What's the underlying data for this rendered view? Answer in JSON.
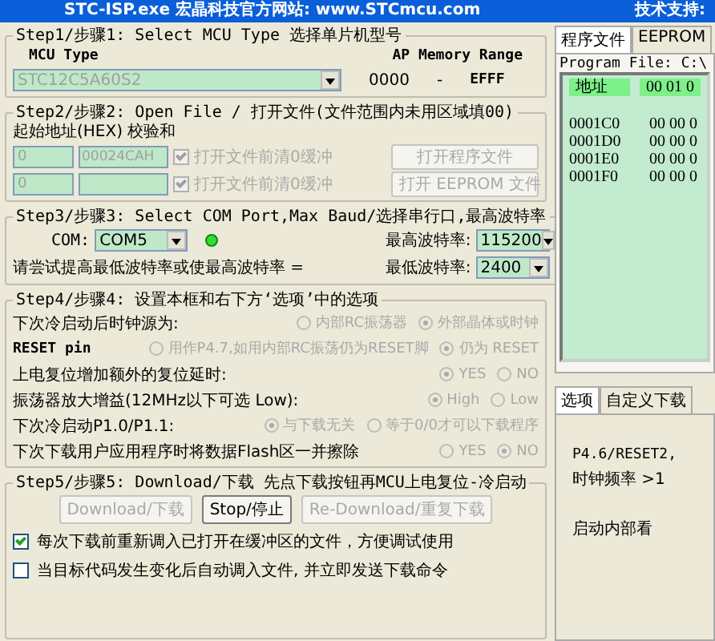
{
  "window": {
    "title": "STC-ISP.exe   宏晶科技官方网站: www.STCmcu.com",
    "title_right": "技术支持:"
  },
  "step1": {
    "legend": "Step1/步骤1: Select MCU Type  选择单片机型号",
    "mcu_label": "MCU Type",
    "mcu_value": "STC12C5A60S2",
    "mcu_disabled": true,
    "range_label": "AP Memory Range",
    "range_from": "0000",
    "range_sep": "-",
    "range_to": "EFFF"
  },
  "step2": {
    "legend": "Step2/步骤2: Open File / 打开文件(文件范围内未用区域填00)",
    "header": "起始地址(HEX) 校验和",
    "rows": [
      {
        "start": "0",
        "checksum": "00024CAH",
        "clear_label": "打开文件前清0缓冲",
        "checked": true,
        "disabled": true,
        "button": "打开程序文件"
      },
      {
        "start": "0",
        "checksum": "",
        "clear_label": "打开文件前清0缓冲",
        "checked": true,
        "disabled": true,
        "button": "打开 EEPROM 文件"
      }
    ]
  },
  "step3": {
    "legend": "Step3/步骤3: Select COM Port,Max Baud/选择串行口,最高波特率",
    "com_label": "COM:",
    "com_value": "COM5",
    "connected": true,
    "max_label": "最高波特率:",
    "max_value": "115200",
    "hint": "请尝试提高最低波特率或使最高波特率 =",
    "min_label": "最低波特率:",
    "min_value": "2400"
  },
  "step4": {
    "legend": "Step4/步骤4: 设置本框和右下方‘选项’中的选项",
    "disabled": true,
    "rows": [
      {
        "label": "下次冷启动后时钟源为:",
        "options": [
          {
            "label": "内部RC振荡器",
            "selected": false
          },
          {
            "label": "外部晶体或时钟",
            "selected": true
          }
        ]
      },
      {
        "label": "RESET pin",
        "options": [
          {
            "label": "用作P4.7,如用内部RC振荡仍为RESET脚",
            "selected": false
          },
          {
            "label": "仍为 RESET",
            "selected": true
          }
        ]
      },
      {
        "label": "上电复位增加额外的复位延时:",
        "options": [
          {
            "label": "YES",
            "selected": true
          },
          {
            "label": "NO",
            "selected": false
          }
        ]
      },
      {
        "label": "振荡器放大增益(12MHz以下可选 Low):",
        "options": [
          {
            "label": "High",
            "selected": true
          },
          {
            "label": "Low",
            "selected": false
          }
        ]
      },
      {
        "label": "下次冷启动P1.0/P1.1:",
        "options": [
          {
            "label": "与下载无关",
            "selected": true
          },
          {
            "label": "等于0/0才可以下载程序",
            "selected": false
          }
        ]
      },
      {
        "label": "下次下载用户应用程序时将数据Flash区一并擦除",
        "options": [
          {
            "label": "YES",
            "selected": false
          },
          {
            "label": "NO",
            "selected": true
          }
        ]
      }
    ]
  },
  "step5": {
    "legend": "Step5/步骤5: Download/下载  先点下载按钮再MCU上电复位-冷启动",
    "buttons": [
      {
        "label": "Download/下载",
        "disabled": true
      },
      {
        "label": "Stop/停止",
        "disabled": false
      },
      {
        "label": "Re-Download/重复下载",
        "disabled": true
      }
    ],
    "checks": [
      {
        "label": "每次下载前重新调入已打开在缓冲区的文件，方便调试使用",
        "checked": true
      },
      {
        "label": "当目标代码发生变化后自动调入文件, 并立即发送下载命令",
        "checked": false
      }
    ]
  },
  "file_tabs": [
    {
      "label": "程序文件",
      "selected": true
    },
    {
      "label": "EEPROM",
      "selected": false
    }
  ],
  "file_path": "Program File: C:\\",
  "hex": {
    "columns": [
      "地址",
      "00 01 0"
    ],
    "rows": [
      [
        "0001C0",
        "00 00 0"
      ],
      [
        "0001D0",
        "00 00 0"
      ],
      [
        "0001E0",
        "00 00 0"
      ],
      [
        "0001F0",
        "00 00 0"
      ]
    ]
  },
  "option_tabs": [
    {
      "label": "选项",
      "selected": true
    },
    {
      "label": "自定义下载",
      "selected": false
    }
  ],
  "option_lines": [
    "P4.6/RESET2,",
    "时钟频率 >1",
    "启动内部看"
  ]
}
